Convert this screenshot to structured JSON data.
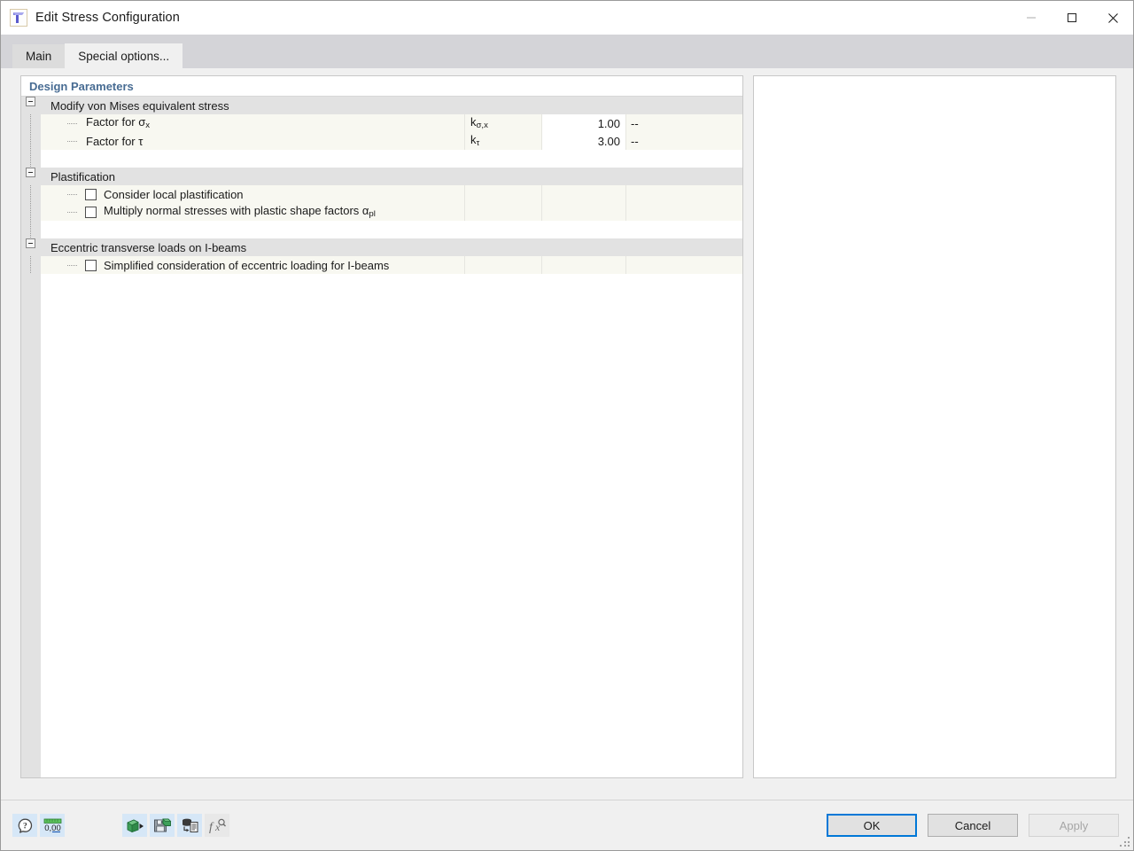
{
  "window": {
    "title": "Edit Stress Configuration",
    "icon": "t-beam-section-icon",
    "minimize_label": "Minimize",
    "maximize_label": "Maximize",
    "close_label": "Close"
  },
  "tabs": [
    {
      "label": "Main",
      "active": false
    },
    {
      "label": "Special options...",
      "active": true
    }
  ],
  "grid": {
    "title": "Design Parameters",
    "sections": [
      {
        "label": "Modify von Mises equivalent stress",
        "expanded": true,
        "rows": [
          {
            "label": "Factor for σx",
            "label_base": "Factor for σ",
            "label_sub": "x",
            "symbol_base": "k",
            "symbol_sub": "σ,x",
            "value": "1.00",
            "unit": "--",
            "type": "value"
          },
          {
            "label": "Factor for τ",
            "label_base": "Factor for τ",
            "label_sub": "",
            "symbol_base": "k",
            "symbol_sub": "τ",
            "value": "3.00",
            "unit": "--",
            "type": "value"
          }
        ]
      },
      {
        "label": "Plastification",
        "expanded": true,
        "rows": [
          {
            "label_base": "Consider local plastification",
            "label_sub": "",
            "checked": false,
            "value": "",
            "unit": "",
            "type": "checkbox"
          },
          {
            "label_base": "Multiply normal stresses with plastic shape factors α",
            "label_sub": "pl",
            "checked": false,
            "value": "",
            "unit": "",
            "type": "checkbox"
          }
        ]
      },
      {
        "label": "Eccentric transverse loads on I-beams",
        "expanded": true,
        "rows": [
          {
            "label_base": "Simplified consideration of eccentric loading for I-beams",
            "label_sub": "",
            "checked": false,
            "value": "",
            "unit": "",
            "type": "checkbox"
          }
        ]
      }
    ]
  },
  "toolbar": {
    "left": [
      {
        "name": "help-icon",
        "title": "Help"
      },
      {
        "name": "units-decimal-places-icon",
        "title": "Units and decimal places",
        "text": "0,00"
      }
    ],
    "right": [
      {
        "name": "import-icon",
        "title": "Import"
      },
      {
        "name": "save-icon",
        "title": "Save"
      },
      {
        "name": "database-to-document-icon",
        "title": "Create from database"
      },
      {
        "name": "formula-fx-icon",
        "title": "Formula"
      }
    ]
  },
  "buttons": {
    "ok": "OK",
    "cancel": "Cancel",
    "apply": "Apply"
  }
}
